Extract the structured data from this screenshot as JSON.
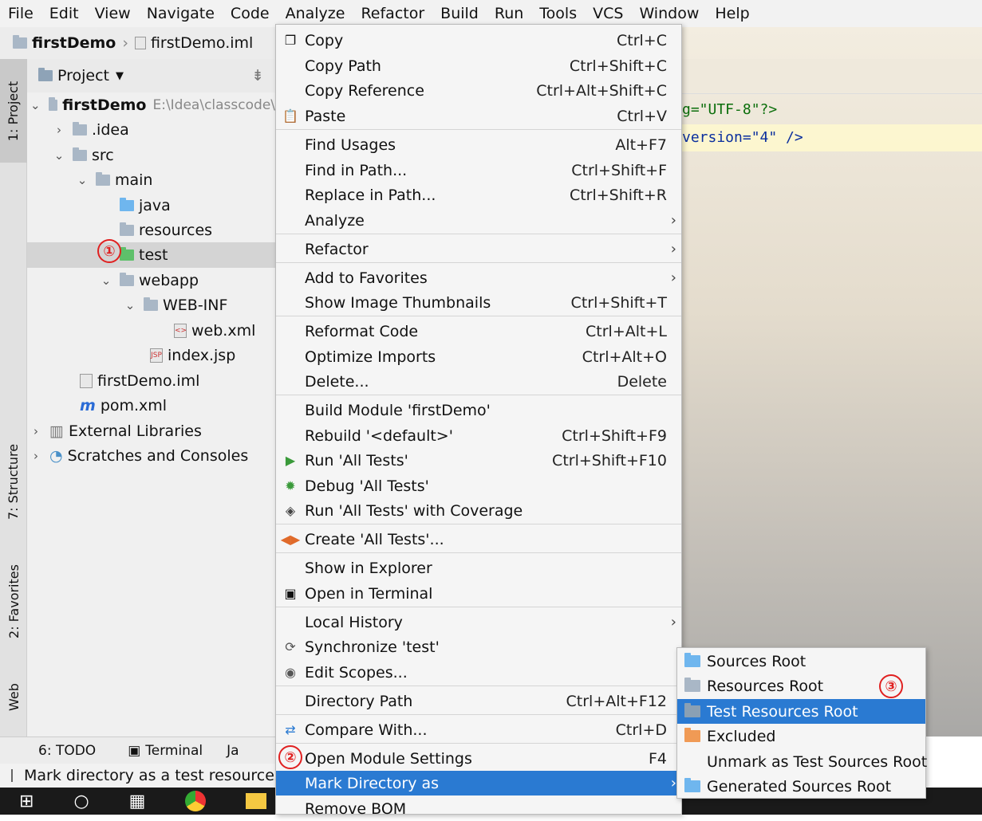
{
  "menubar": [
    "File",
    "Edit",
    "View",
    "Navigate",
    "Code",
    "Analyze",
    "Refactor",
    "Build",
    "Run",
    "Tools",
    "VCS",
    "Window",
    "Help"
  ],
  "breadcrumb": {
    "project": "firstDemo",
    "file": "firstDemo.iml"
  },
  "project_panel": {
    "title": "Project"
  },
  "left_tabs": {
    "project": "1: Project",
    "structure": "7: Structure",
    "favorites": "2: Favorites",
    "web": "Web"
  },
  "tree": [
    {
      "label": "firstDemo",
      "extra": "E:\\Idea\\classcode\\"
    },
    {
      "label": ".idea"
    },
    {
      "label": "src"
    },
    {
      "label": "main"
    },
    {
      "label": "java"
    },
    {
      "label": "resources"
    },
    {
      "label": "test"
    },
    {
      "label": "webapp"
    },
    {
      "label": "WEB-INF"
    },
    {
      "label": "web.xml"
    },
    {
      "label": "index.jsp"
    },
    {
      "label": "firstDemo.iml"
    },
    {
      "label": "pom.xml"
    },
    {
      "label": "External Libraries"
    },
    {
      "label": "Scratches and Consoles"
    }
  ],
  "editor": {
    "line1": "g=\"UTF-8\"?>",
    "line2": "version=\"4\" />"
  },
  "bottom_tabs": {
    "todo": "6: TODO",
    "terminal": "Terminal",
    "other": "Ja"
  },
  "status": "Mark directory as a test resources r",
  "badges": {
    "b1": "①",
    "b2": "②",
    "b3": "③"
  },
  "context_menu": [
    {
      "label": "Copy",
      "shortcut": "Ctrl+C"
    },
    {
      "label": "Copy Path",
      "shortcut": "Ctrl+Shift+C"
    },
    {
      "label": "Copy Reference",
      "shortcut": "Ctrl+Alt+Shift+C"
    },
    {
      "label": "Paste",
      "shortcut": "Ctrl+V"
    },
    {
      "label": "Find Usages",
      "shortcut": "Alt+F7"
    },
    {
      "label": "Find in Path...",
      "shortcut": "Ctrl+Shift+F"
    },
    {
      "label": "Replace in Path...",
      "shortcut": "Ctrl+Shift+R"
    },
    {
      "label": "Analyze"
    },
    {
      "label": "Refactor"
    },
    {
      "label": "Add to Favorites"
    },
    {
      "label": "Show Image Thumbnails",
      "shortcut": "Ctrl+Shift+T"
    },
    {
      "label": "Reformat Code",
      "shortcut": "Ctrl+Alt+L"
    },
    {
      "label": "Optimize Imports",
      "shortcut": "Ctrl+Alt+O"
    },
    {
      "label": "Delete...",
      "shortcut": "Delete"
    },
    {
      "label": "Build Module 'firstDemo'"
    },
    {
      "label": "Rebuild '<default>'",
      "shortcut": "Ctrl+Shift+F9"
    },
    {
      "label": "Run 'All Tests'",
      "shortcut": "Ctrl+Shift+F10"
    },
    {
      "label": "Debug 'All Tests'"
    },
    {
      "label": "Run 'All Tests' with Coverage"
    },
    {
      "label": "Create 'All Tests'..."
    },
    {
      "label": "Show in Explorer"
    },
    {
      "label": "Open in Terminal"
    },
    {
      "label": "Local History"
    },
    {
      "label": "Synchronize 'test'"
    },
    {
      "label": "Edit Scopes..."
    },
    {
      "label": "Directory Path",
      "shortcut": "Ctrl+Alt+F12"
    },
    {
      "label": "Compare With...",
      "shortcut": "Ctrl+D"
    },
    {
      "label": "Open Module Settings",
      "shortcut": "F4"
    },
    {
      "label": "Mark Directory as"
    },
    {
      "label": "Remove BOM"
    }
  ],
  "submenu": [
    "Sources Root",
    "Resources Root",
    "Test Resources Root",
    "Excluded",
    "Unmark as Test Sources Root",
    "Generated Sources Root"
  ],
  "colors": {
    "highlight": "#2a7ad2",
    "badge": "#e02020",
    "test_folder": "#5ec06a",
    "source_folder": "#6fb6ee"
  }
}
